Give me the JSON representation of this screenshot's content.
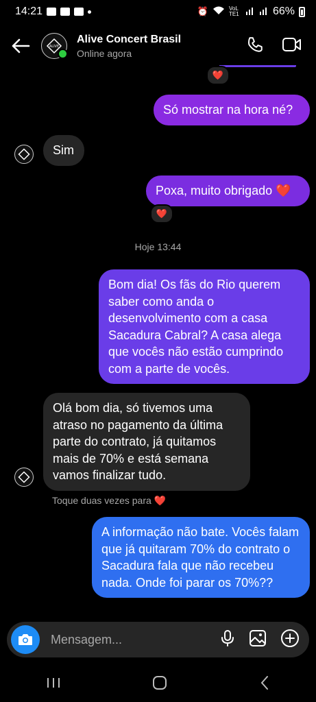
{
  "status_bar": {
    "time": "14:21",
    "network": "VoLTE1",
    "battery": "66%"
  },
  "header": {
    "title": "Alive Concert Brasil",
    "subtitle": "Online agora",
    "avatar_text": "ALIVE"
  },
  "messages": [
    {
      "id": "m1",
      "direction": "out",
      "text": "Só mostrar na hora né?"
    },
    {
      "id": "m2",
      "direction": "in",
      "text": "Sim"
    },
    {
      "id": "m3",
      "direction": "out",
      "text": "Poxa, muito obrigado ❤️",
      "reaction": "❤️"
    },
    {
      "id": "m4",
      "direction": "out",
      "text": "Bom dia! Os fãs do Rio querem saber como anda o desenvolvimento com a casa Sacadura Cabral? A casa alega que vocês não estão cumprindo com a parte de vocês."
    },
    {
      "id": "m5",
      "direction": "in",
      "text": "Olá bom dia, só tivemos uma atraso no pagamento da última parte do contrato, já quitamos mais de 70% e está semana vamos finalizar tudo."
    },
    {
      "id": "m6",
      "direction": "out",
      "text": "A informação não bate. Vocês falam que já quitaram 70% do contrato o Sacadura fala que não recebeu nada. Onde foi parar os 70%??"
    }
  ],
  "top_reaction": "❤️",
  "timestamp": "Hoje 13:44",
  "double_tap_hint": "Toque duas vezes para ❤️",
  "composer": {
    "placeholder": "Mensagem..."
  },
  "colors": {
    "bubble_purple": "#8a2be2",
    "bubble_violet": "#6a3de8",
    "bubble_blue": "#2f6ff0",
    "incoming": "#262626",
    "accent_blue": "#1d8cf6",
    "online": "#2ecc40"
  }
}
